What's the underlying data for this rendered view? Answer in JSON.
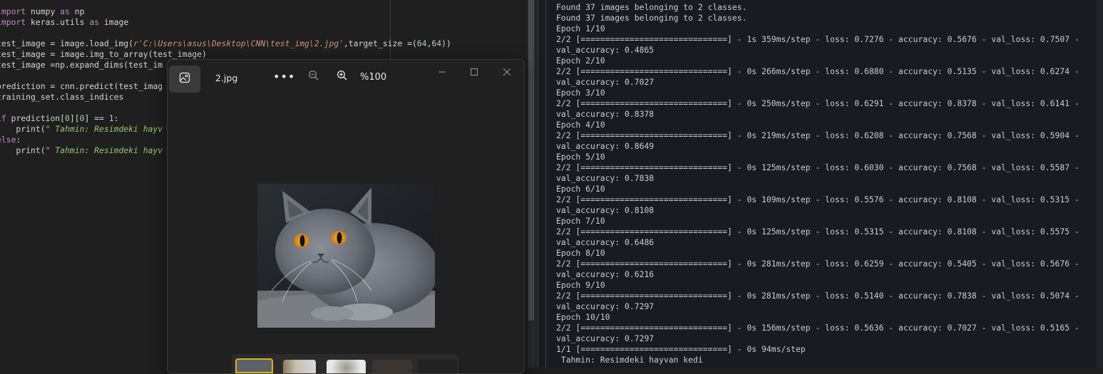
{
  "editor": {
    "lines": [
      [
        {
          "t": "import",
          "c": "kw"
        },
        {
          "t": " numpy "
        },
        {
          "t": "as",
          "c": "kw"
        },
        {
          "t": " np"
        }
      ],
      [
        {
          "t": "import",
          "c": "kw"
        },
        {
          "t": " keras.utils "
        },
        {
          "t": "as",
          "c": "kw"
        },
        {
          "t": " image"
        }
      ],
      [],
      [
        {
          "t": "test_image = image.load_img("
        },
        {
          "t": "r'C:\\Users\\asus\\Desktop\\CNN\\test_img\\2.jpg'",
          "c": "str"
        },
        {
          "t": ",target_size =("
        },
        {
          "t": "64",
          "c": "num"
        },
        {
          "t": ","
        },
        {
          "t": "64",
          "c": "num"
        },
        {
          "t": "))"
        }
      ],
      [
        {
          "t": "test_image = image.img_to_array(test_image)"
        }
      ],
      [
        {
          "t": "test_image =np.expand_dims(test_im"
        }
      ],
      [],
      [
        {
          "t": "prediction = cnn.predict(test_imag"
        }
      ],
      [
        {
          "t": "training_set.class_indices"
        }
      ],
      [],
      [
        {
          "t": "if",
          "c": "kw"
        },
        {
          "t": " prediction["
        },
        {
          "t": "0",
          "c": "num"
        },
        {
          "t": "]["
        },
        {
          "t": "0",
          "c": "num"
        },
        {
          "t": "] == "
        },
        {
          "t": "1",
          "c": "num"
        },
        {
          "t": ":"
        }
      ],
      [
        {
          "t": "    print("
        },
        {
          "t": "\" Tahmin: Resimdeki hayv",
          "c": "gstr"
        }
      ],
      [
        {
          "t": "else",
          "c": "kw"
        },
        {
          "t": ":"
        }
      ],
      [
        {
          "t": "    print("
        },
        {
          "t": "\" Tahmin: Resimdeki hayv",
          "c": "gstr"
        }
      ]
    ]
  },
  "viewer": {
    "filename": "2.jpg",
    "zoom": "%100",
    "more_label": "•••"
  },
  "terminal": {
    "lines": [
      "Found 37 images belonging to 2 classes.",
      "Found 37 images belonging to 2 classes.",
      "Epoch 1/10",
      "2/2 [==============================] - 1s 359ms/step - loss: 0.7276 - accuracy: 0.5676 - val_loss: 0.7507 -",
      "val_accuracy: 0.4865",
      "Epoch 2/10",
      "2/2 [==============================] - 0s 266ms/step - loss: 0.6880 - accuracy: 0.5135 - val_loss: 0.6274 -",
      "val_accuracy: 0.7027",
      "Epoch 3/10",
      "2/2 [==============================] - 0s 250ms/step - loss: 0.6291 - accuracy: 0.8378 - val_loss: 0.6141 -",
      "val_accuracy: 0.8378",
      "Epoch 4/10",
      "2/2 [==============================] - 0s 219ms/step - loss: 0.6208 - accuracy: 0.7568 - val_loss: 0.5904 -",
      "val_accuracy: 0.8649",
      "Epoch 5/10",
      "2/2 [==============================] - 0s 125ms/step - loss: 0.6030 - accuracy: 0.7568 - val_loss: 0.5587 -",
      "val_accuracy: 0.7838",
      "Epoch 6/10",
      "2/2 [==============================] - 0s 109ms/step - loss: 0.5576 - accuracy: 0.8108 - val_loss: 0.5315 -",
      "val_accuracy: 0.8108",
      "Epoch 7/10",
      "2/2 [==============================] - 0s 125ms/step - loss: 0.5315 - accuracy: 0.8108 - val_loss: 0.5575 -",
      "val_accuracy: 0.6486",
      "Epoch 8/10",
      "2/2 [==============================] - 0s 281ms/step - loss: 0.6259 - accuracy: 0.5405 - val_loss: 0.5676 -",
      "val_accuracy: 0.6216",
      "Epoch 9/10",
      "2/2 [==============================] - 0s 281ms/step - loss: 0.5140 - accuracy: 0.7838 - val_loss: 0.5074 -",
      "val_accuracy: 0.7297",
      "Epoch 10/10",
      "2/2 [==============================] - 0s 156ms/step - loss: 0.5636 - accuracy: 0.7027 - val_loss: 0.5165 -",
      "val_accuracy: 0.7297",
      "1/1 [==============================] - 0s 94ms/step",
      " Tahmin: Resimdeki hayvan kedi"
    ]
  },
  "icons": {
    "viewer_app": "image-icon",
    "more": "more-options-icon",
    "zoom_out": "zoom-out-icon",
    "zoom_in": "zoom-in-icon",
    "minimize": "minimize-icon",
    "maximize": "maximize-icon",
    "close": "close-icon"
  },
  "colors": {
    "editor_bg": "#1f1f1f",
    "terminal_bg": "#181b1f",
    "viewer_bg": "#202020",
    "keyword": "#c586c0",
    "string": "#ce9178",
    "number": "#b5cea8"
  }
}
